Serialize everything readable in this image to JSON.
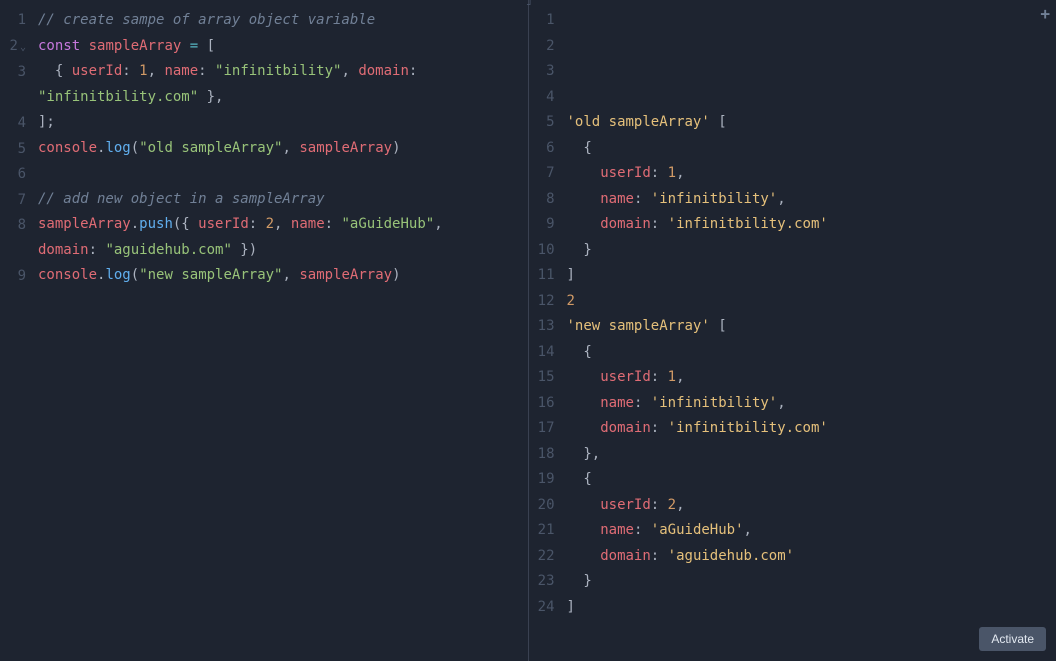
{
  "buttons": {
    "activate": "Activate",
    "add": "+"
  },
  "left_pane": {
    "line_numbers": [
      "1",
      "2",
      "3",
      "",
      "4",
      "5",
      "6",
      "7",
      "8",
      "",
      "9"
    ],
    "fold_on_line": 2,
    "code_lines": [
      [
        {
          "t": "// create sampe of array object variable",
          "c": "comment"
        }
      ],
      [
        {
          "t": "const",
          "c": "keyword"
        },
        {
          "t": " ",
          "c": "plain"
        },
        {
          "t": "sampleArray",
          "c": "identifier"
        },
        {
          "t": " ",
          "c": "plain"
        },
        {
          "t": "=",
          "c": "operator"
        },
        {
          "t": " [",
          "c": "punctuation"
        }
      ],
      [
        {
          "t": "  { ",
          "c": "punctuation"
        },
        {
          "t": "userId",
          "c": "property"
        },
        {
          "t": ": ",
          "c": "punctuation"
        },
        {
          "t": "1",
          "c": "number"
        },
        {
          "t": ", ",
          "c": "punctuation"
        },
        {
          "t": "name",
          "c": "property"
        },
        {
          "t": ": ",
          "c": "punctuation"
        },
        {
          "t": "\"infinitbility\"",
          "c": "string"
        },
        {
          "t": ", ",
          "c": "punctuation"
        },
        {
          "t": "domain",
          "c": "property"
        },
        {
          "t": ": ",
          "c": "punctuation"
        }
      ],
      [
        {
          "t": "\"infinitbility.com\"",
          "c": "string"
        },
        {
          "t": " },",
          "c": "punctuation"
        }
      ],
      [
        {
          "t": "];",
          "c": "punctuation"
        }
      ],
      [
        {
          "t": "console",
          "c": "identifier"
        },
        {
          "t": ".",
          "c": "punctuation"
        },
        {
          "t": "log",
          "c": "method"
        },
        {
          "t": "(",
          "c": "punctuation"
        },
        {
          "t": "\"old sampleArray\"",
          "c": "string"
        },
        {
          "t": ", ",
          "c": "punctuation"
        },
        {
          "t": "sampleArray",
          "c": "identifier"
        },
        {
          "t": ")",
          "c": "punctuation"
        }
      ],
      [
        {
          "t": "",
          "c": "plain"
        }
      ],
      [
        {
          "t": "// add new object in a sampleArray",
          "c": "comment"
        }
      ],
      [
        {
          "t": "sampleArray",
          "c": "identifier"
        },
        {
          "t": ".",
          "c": "punctuation"
        },
        {
          "t": "push",
          "c": "method"
        },
        {
          "t": "({ ",
          "c": "punctuation"
        },
        {
          "t": "userId",
          "c": "property"
        },
        {
          "t": ": ",
          "c": "punctuation"
        },
        {
          "t": "2",
          "c": "number"
        },
        {
          "t": ", ",
          "c": "punctuation"
        },
        {
          "t": "name",
          "c": "property"
        },
        {
          "t": ": ",
          "c": "punctuation"
        },
        {
          "t": "\"aGuideHub\"",
          "c": "string"
        },
        {
          "t": ", ",
          "c": "punctuation"
        }
      ],
      [
        {
          "t": "domain",
          "c": "property"
        },
        {
          "t": ": ",
          "c": "punctuation"
        },
        {
          "t": "\"aguidehub.com\"",
          "c": "string"
        },
        {
          "t": " })",
          "c": "punctuation"
        }
      ],
      [
        {
          "t": "console",
          "c": "identifier"
        },
        {
          "t": ".",
          "c": "punctuation"
        },
        {
          "t": "log",
          "c": "method"
        },
        {
          "t": "(",
          "c": "punctuation"
        },
        {
          "t": "\"new sampleArray\"",
          "c": "string"
        },
        {
          "t": ", ",
          "c": "punctuation"
        },
        {
          "t": "sampleArray",
          "c": "identifier"
        },
        {
          "t": ")",
          "c": "punctuation"
        }
      ]
    ]
  },
  "right_pane": {
    "line_numbers": [
      "1",
      "2",
      "3",
      "4",
      "5",
      "6",
      "7",
      "8",
      "9",
      "10",
      "11",
      "12",
      "13",
      "14",
      "15",
      "16",
      "17",
      "18",
      "19",
      "20",
      "21",
      "22",
      "23",
      "24"
    ],
    "code_lines": [
      [
        {
          "t": "",
          "c": "plain"
        }
      ],
      [
        {
          "t": "",
          "c": "plain"
        }
      ],
      [
        {
          "t": "",
          "c": "plain"
        }
      ],
      [
        {
          "t": "",
          "c": "plain"
        }
      ],
      [
        {
          "t": "'old sampleArray'",
          "c": "string-alt"
        },
        {
          "t": " [",
          "c": "plain"
        }
      ],
      [
        {
          "t": "  {",
          "c": "plain"
        }
      ],
      [
        {
          "t": "    ",
          "c": "plain"
        },
        {
          "t": "userId",
          "c": "property"
        },
        {
          "t": ": ",
          "c": "plain"
        },
        {
          "t": "1",
          "c": "number"
        },
        {
          "t": ",",
          "c": "plain"
        }
      ],
      [
        {
          "t": "    ",
          "c": "plain"
        },
        {
          "t": "name",
          "c": "property"
        },
        {
          "t": ": ",
          "c": "plain"
        },
        {
          "t": "'infinitbility'",
          "c": "string-alt"
        },
        {
          "t": ",",
          "c": "plain"
        }
      ],
      [
        {
          "t": "    ",
          "c": "plain"
        },
        {
          "t": "domain",
          "c": "property"
        },
        {
          "t": ": ",
          "c": "plain"
        },
        {
          "t": "'infinitbility.com'",
          "c": "string-alt"
        }
      ],
      [
        {
          "t": "  }",
          "c": "plain"
        }
      ],
      [
        {
          "t": "]",
          "c": "plain"
        }
      ],
      [
        {
          "t": "2",
          "c": "number"
        }
      ],
      [
        {
          "t": "'new sampleArray'",
          "c": "string-alt"
        },
        {
          "t": " [",
          "c": "plain"
        }
      ],
      [
        {
          "t": "  {",
          "c": "plain"
        }
      ],
      [
        {
          "t": "    ",
          "c": "plain"
        },
        {
          "t": "userId",
          "c": "property"
        },
        {
          "t": ": ",
          "c": "plain"
        },
        {
          "t": "1",
          "c": "number"
        },
        {
          "t": ",",
          "c": "plain"
        }
      ],
      [
        {
          "t": "    ",
          "c": "plain"
        },
        {
          "t": "name",
          "c": "property"
        },
        {
          "t": ": ",
          "c": "plain"
        },
        {
          "t": "'infinitbility'",
          "c": "string-alt"
        },
        {
          "t": ",",
          "c": "plain"
        }
      ],
      [
        {
          "t": "    ",
          "c": "plain"
        },
        {
          "t": "domain",
          "c": "property"
        },
        {
          "t": ": ",
          "c": "plain"
        },
        {
          "t": "'infinitbility.com'",
          "c": "string-alt"
        }
      ],
      [
        {
          "t": "  },",
          "c": "plain"
        }
      ],
      [
        {
          "t": "  {",
          "c": "plain"
        }
      ],
      [
        {
          "t": "    ",
          "c": "plain"
        },
        {
          "t": "userId",
          "c": "property"
        },
        {
          "t": ": ",
          "c": "plain"
        },
        {
          "t": "2",
          "c": "number"
        },
        {
          "t": ",",
          "c": "plain"
        }
      ],
      [
        {
          "t": "    ",
          "c": "plain"
        },
        {
          "t": "name",
          "c": "property"
        },
        {
          "t": ": ",
          "c": "plain"
        },
        {
          "t": "'aGuideHub'",
          "c": "string-alt"
        },
        {
          "t": ",",
          "c": "plain"
        }
      ],
      [
        {
          "t": "    ",
          "c": "plain"
        },
        {
          "t": "domain",
          "c": "property"
        },
        {
          "t": ": ",
          "c": "plain"
        },
        {
          "t": "'aguidehub.com'",
          "c": "string-alt"
        }
      ],
      [
        {
          "t": "  }",
          "c": "plain"
        }
      ],
      [
        {
          "t": "]",
          "c": "plain"
        }
      ]
    ]
  }
}
